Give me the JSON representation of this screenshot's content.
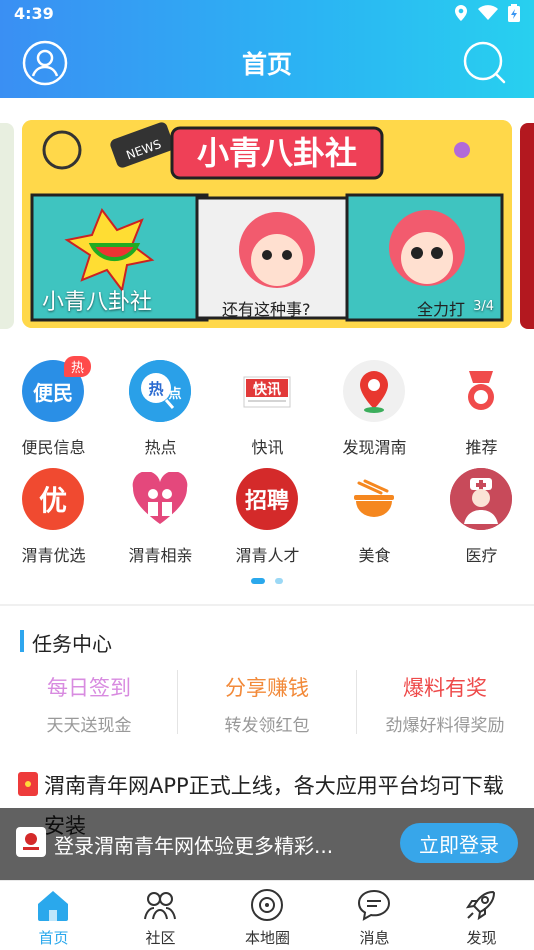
{
  "status": {
    "time": "4:39"
  },
  "header": {
    "title": "首页"
  },
  "banner": {
    "caption": "小青八卦社",
    "page": "3/4"
  },
  "grid": {
    "row1": [
      {
        "label": "便民信息",
        "icon": "便民",
        "color": "#2a8fe6",
        "badge": "热"
      },
      {
        "label": "热点",
        "icon": "热点",
        "color": "#2aa0e8"
      },
      {
        "label": "快讯",
        "icon": "快讯",
        "color": "#e63b3b"
      },
      {
        "label": "发现渭南",
        "icon": "location-pin-icon",
        "color": "#e8372f"
      },
      {
        "label": "推荐",
        "icon": "ribbon-icon",
        "color": "#f04b4b"
      }
    ],
    "row2": [
      {
        "label": "渭青优选",
        "icon": "优",
        "color": "#f04a30"
      },
      {
        "label": "渭青相亲",
        "icon": "heart-couple-icon",
        "color": "#e4487c"
      },
      {
        "label": "渭青人才",
        "icon": "招聘",
        "color": "#d42a2a"
      },
      {
        "label": "美食",
        "icon": "noodle-bowl-icon",
        "color": "#f5871f"
      },
      {
        "label": "医疗",
        "icon": "nurse-icon",
        "color": "#c84a5a"
      }
    ]
  },
  "task": {
    "title": "任务中心",
    "items": [
      {
        "main": "每日签到",
        "sub": "天天送现金",
        "color": "#d88be0"
      },
      {
        "main": "分享赚钱",
        "sub": "转发领红包",
        "color": "#f28a3a"
      },
      {
        "main": "爆料有奖",
        "sub": "劲爆好料得奖励",
        "color": "#ee4a4a"
      }
    ]
  },
  "news": {
    "title": "渭南青年网APP正式上线，各大应用平台均可下载安装"
  },
  "login": {
    "text": "登录渭南青年网体验更多精彩...",
    "button": "立即登录"
  },
  "nav": [
    {
      "label": "首页",
      "icon": "home-icon"
    },
    {
      "label": "社区",
      "icon": "community-icon"
    },
    {
      "label": "本地圈",
      "icon": "local-circle-icon"
    },
    {
      "label": "消息",
      "icon": "message-icon"
    },
    {
      "label": "发现",
      "icon": "rocket-icon"
    }
  ],
  "colors": {
    "accent": "#2aa8ec",
    "header_start": "#3a8ff3",
    "header_end": "#28d0ef"
  }
}
